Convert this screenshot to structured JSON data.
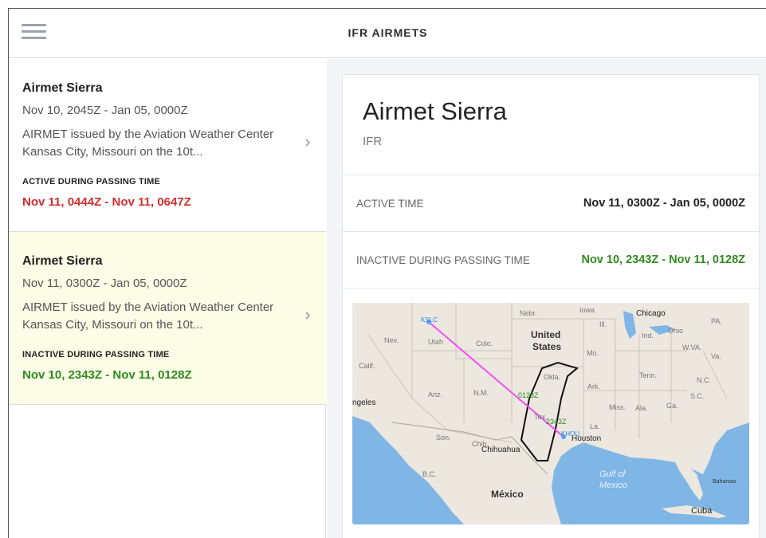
{
  "topbar": {
    "title": "IFR AIRMETS",
    "menu_icon": "hamburger-menu-icon"
  },
  "list": {
    "items": [
      {
        "title": "Airmet Sierra",
        "dates": "Nov 10, 2045Z - Jan 05, 0000Z",
        "description_line1": "AIRMET issued by the Aviation Weather Center",
        "description_line2": "Kansas City, Missouri on the 10t...",
        "status_label": "ACTIVE DURING PASSING TIME",
        "status_time": "Nov 11, 0444Z - Nov 11, 0647Z",
        "status_color": "#d32f2f",
        "selected": false
      },
      {
        "title": "Airmet Sierra",
        "dates": "Nov 11, 0300Z - Jan 05, 0000Z",
        "description_line1": "AIRMET issued by the Aviation Weather Center",
        "description_line2": "Kansas City, Missouri on the 10t...",
        "status_label": "INACTIVE DURING PASSING TIME",
        "status_time": "Nov 10, 2343Z - Nov 11, 0128Z",
        "status_color": "#2e8b1f",
        "selected": true,
        "selected_background": "#fcfde6"
      }
    ],
    "chevron_icon": "chevron-right-icon"
  },
  "detail": {
    "title": "Airmet Sierra",
    "subtitle": "IFR",
    "active_time_label": "ACTIVE TIME",
    "active_time_value": "Nov 11, 0300Z - Jan 05, 0000Z",
    "inactive_label": "INACTIVE DURING PASSING TIME",
    "inactive_value": "Nov 10, 2343Z - Nov 11, 0128Z",
    "inactive_color": "#2e8b1f"
  },
  "map": {
    "route_color": "#f04ff0",
    "water_color": "#7fb6e6",
    "land_color": "#ece7df",
    "airmet_outline_color": "#111111",
    "labels": {
      "departure": "KSLC",
      "arrival": "KHOU",
      "waypoint1": "0128Z",
      "waypoint2": "2343Z",
      "country_us_line1": "United",
      "country_us_line2": "States",
      "mexico": "México",
      "chicago": "Chicago",
      "houston": "Houston",
      "chihuahua": "Chihuahua",
      "angeles": "ngeles",
      "gulf_line1": "Gulf of",
      "gulf_line2": "Mexico",
      "cuba": "Cuba",
      "bahamas": "Bahamas",
      "nebr": "Nebr.",
      "iowa": "Iowa",
      "nev": "Nev.",
      "utah": "Utah",
      "colo": "Colo.",
      "calif": "Calif.",
      "ariz": "Ariz.",
      "nm": "N.M.",
      "okla": "Okla.",
      "tex": "Tex.",
      "mo": "Mo.",
      "ark": "Ark.",
      "ill": "Ill.",
      "ind": "Ind.",
      "ohio": "Ohio",
      "pa": "PA.",
      "va": "Va.",
      "wva": "W.VA.",
      "tenn": "Tenn.",
      "nc": "N.C.",
      "sc": "S.C.",
      "ga": "Ga.",
      "ala": "Ala.",
      "miss": "Miss.",
      "la": "La.",
      "son": "Son.",
      "chih": "Chih.",
      "bc": "B.C."
    }
  }
}
